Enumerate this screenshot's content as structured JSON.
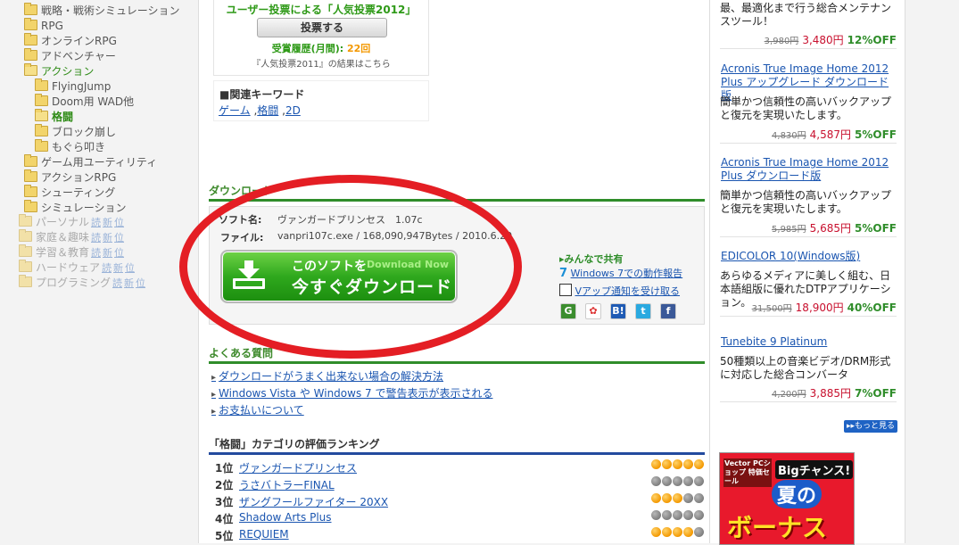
{
  "sidebar": {
    "items": [
      {
        "label": "戦略・戦術シミュレーション",
        "indent": 1,
        "state": "normal"
      },
      {
        "label": "RPG",
        "indent": 1,
        "state": "normal"
      },
      {
        "label": "オンラインRPG",
        "indent": 1,
        "state": "normal"
      },
      {
        "label": "アドベンチャー",
        "indent": 1,
        "state": "normal"
      },
      {
        "label": "アクション",
        "indent": 1,
        "state": "open"
      },
      {
        "label": "FlyingJump",
        "indent": 2,
        "state": "normal"
      },
      {
        "label": "Doom用 WAD他",
        "indent": 2,
        "state": "normal"
      },
      {
        "label": "格闘",
        "indent": 2,
        "state": "active"
      },
      {
        "label": "ブロック崩し",
        "indent": 2,
        "state": "normal"
      },
      {
        "label": "もぐら叩き",
        "indent": 2,
        "state": "normal"
      },
      {
        "label": "ゲーム用ユーティリティ",
        "indent": 1,
        "state": "normal"
      },
      {
        "label": "アクションRPG",
        "indent": 1,
        "state": "normal"
      },
      {
        "label": "シューティング",
        "indent": 1,
        "state": "normal"
      },
      {
        "label": "シミュレーション",
        "indent": 1,
        "state": "normal"
      }
    ],
    "top_items": [
      {
        "label": "パーソナル",
        "links": [
          "読",
          "新",
          "位"
        ]
      },
      {
        "label": "家庭＆趣味",
        "links": [
          "読",
          "新",
          "位"
        ]
      },
      {
        "label": "学習＆教育",
        "links": [
          "読",
          "新",
          "位"
        ]
      },
      {
        "label": "ハードウェア",
        "links": [
          "読",
          "新",
          "位"
        ]
      },
      {
        "label": "プログラミング",
        "links": [
          "読",
          "新",
          "位"
        ]
      }
    ]
  },
  "vote": {
    "title": "ユーザー投票による「人気投票2012」",
    "button": "投票する",
    "history_label": "受賞履歴(月間):",
    "history_count": "22回",
    "prev_result": "『人気投票2011』の結果はこちら"
  },
  "keywords": {
    "heading": "■関連キーワード",
    "links": [
      "ゲーム",
      "格闘",
      "2D"
    ],
    "sep1": " ,",
    "sep2": " ,"
  },
  "download": {
    "heading": "ダウンロード",
    "soft_label": "ソフト名:",
    "soft_value": "ヴァンガードプリンセス　1.07c",
    "file_label": "ファイル:",
    "file_value": "vanpri107c.exe / 168,090,947Bytes / 2010.6.20",
    "button_line1": "このソフトを",
    "button_line1b": "Download Now",
    "button_line2": "今すぐダウンロード",
    "share_heading": "みんなで共有",
    "win7_link": "Windows 7での動作報告",
    "update_link": "Vアップ通知を受け取る",
    "win7_icon": "7",
    "social_icons": [
      {
        "name": "google-bookmark-icon",
        "glyph": "G",
        "color": "#3b8d2e"
      },
      {
        "name": "delicious-icon",
        "glyph": "✿",
        "color": "#ffffff"
      },
      {
        "name": "hatena-bookmark-icon",
        "glyph": "B!",
        "color": "#1e5ab4"
      },
      {
        "name": "twitter-icon",
        "glyph": "t",
        "color": "#2aa9e0"
      },
      {
        "name": "facebook-icon",
        "glyph": "f",
        "color": "#3b5998"
      }
    ]
  },
  "faq": {
    "heading": "よくある質問",
    "items": [
      "ダウンロードがうまく出来ない場合の解決方法",
      "Windows Vista や Windows 7 で警告表示が表示される",
      "お支払いについて"
    ]
  },
  "ranking": {
    "heading": "「格闘」カテゴリの評価ランキング",
    "rows": [
      {
        "rank": "1位",
        "name": "ヴァンガードプリンセス",
        "stars": 5
      },
      {
        "rank": "2位",
        "name": "うさバトラーFINAL",
        "stars": 0
      },
      {
        "rank": "3位",
        "name": "ザングフールファイター 20XX",
        "stars": 3
      },
      {
        "rank": "4位",
        "name": "Shadow Arts Plus",
        "stars": 0
      },
      {
        "rank": "5位",
        "name": "REQUIEM",
        "stars": 4
      }
    ]
  },
  "products": [
    {
      "title": "",
      "desc": "最、最適化まで行う総合メンテナンスツール！",
      "old": "3,980円",
      "new": "3,480円",
      "off": "12%OFF"
    },
    {
      "title": "Acronis True Image Home 2012 Plus アップグレード ダウンロード版",
      "desc": "簡単かつ信頼性の高いバックアップと復元を実現いたします。",
      "old": "4,830円",
      "new": "4,587円",
      "off": "5%OFF"
    },
    {
      "title": "Acronis True Image Home 2012 Plus ダウンロード版",
      "desc": "簡単かつ信頼性の高いバックアップと復元を実現いたします。",
      "old": "5,985円",
      "new": "5,685円",
      "off": "5%OFF"
    },
    {
      "title": "EDICOLOR 10(Windows版)",
      "desc": "あらゆるメディアに美しく組む、日本語組版に優れたDTPアプリケーション。",
      "old": "31,500円",
      "new": "18,900円",
      "off": "40%OFF"
    },
    {
      "title": "Tunebite 9 Platinum",
      "desc": "50種類以上の音楽ビデオ/DRM形式に対応した総合コンバータ",
      "old": "4,200円",
      "new": "3,885円",
      "off": "7%OFF"
    }
  ],
  "more_button": "もっと見る",
  "banner": {
    "small": "Vector PCショップ 特価セール",
    "chance": "Bigチャンス!",
    "big1": "夏の",
    "big2": "ボーナス"
  },
  "colors": {
    "accent_green": "#2f8d2a",
    "link_blue": "#1a55b0",
    "price_red": "#c8102e",
    "annotation_red": "#e41e24"
  }
}
